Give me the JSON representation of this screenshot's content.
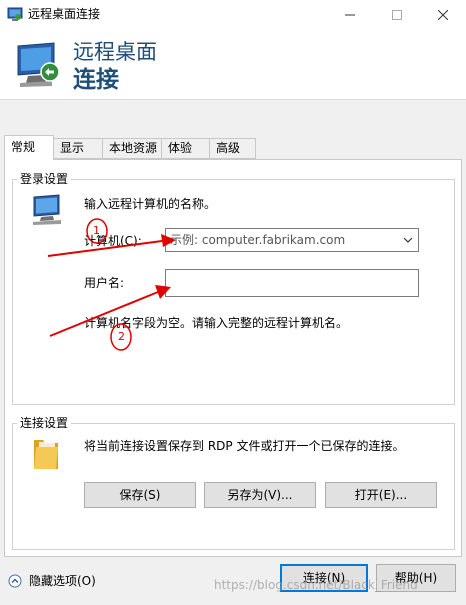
{
  "window": {
    "title": "远程桌面连接"
  },
  "banner": {
    "line1": "远程桌面",
    "line2": "连接"
  },
  "tabs": [
    {
      "label": "常规",
      "active": true
    },
    {
      "label": "显示",
      "active": false
    },
    {
      "label": "本地资源",
      "active": false
    },
    {
      "label": "体验",
      "active": false
    },
    {
      "label": "高级",
      "active": false
    }
  ],
  "login_settings": {
    "title": "登录设置",
    "instruction": "输入远程计算机的名称。",
    "computer_label": "计算机(C):",
    "computer_placeholder": "示例: computer.fabrikam.com",
    "username_label": "用户名:",
    "username_value": "",
    "hint": "计算机名字段为空。请输入完整的远程计算机名。"
  },
  "connection_settings": {
    "title": "连接设置",
    "description": "将当前连接设置保存到 RDP 文件或打开一个已保存的连接。",
    "save_button": "保存(S)",
    "save_as_button": "另存为(V)...",
    "open_button": "打开(E)..."
  },
  "footer": {
    "hide_options": "隐藏选项(O)",
    "connect_button": "连接(N)",
    "help_button": "帮助(H)"
  },
  "annotations": {
    "marker1": "1",
    "marker2": "2"
  },
  "watermark": "https://blog.csdn.net/Black_Friend",
  "colors": {
    "banner_text": "#1f4e79",
    "accent": "#0078d7",
    "annotation": "#e00000"
  },
  "icons": {
    "title": "rdp-monitor-icon",
    "banner": "rdp-monitor-icon",
    "login": "computer-icon",
    "connection": "folder-icon",
    "hide_options": "chevron-up-circle-icon"
  }
}
